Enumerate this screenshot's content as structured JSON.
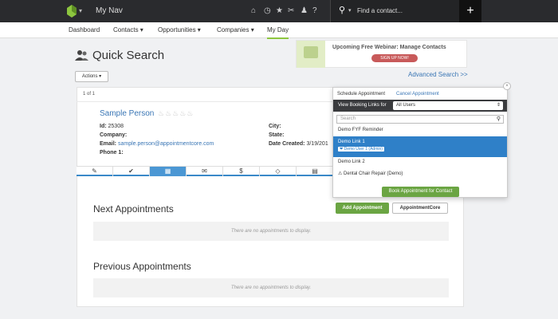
{
  "topbar": {
    "title": "My Nav",
    "search_placeholder": "Find a contact...",
    "icons": [
      "home-icon",
      "clock-icon",
      "star-icon",
      "tools-icon",
      "user-icon",
      "help-icon"
    ],
    "plus_label": "+"
  },
  "subnav": {
    "items": [
      {
        "label": "Dashboard"
      },
      {
        "label": "Contacts ▾"
      },
      {
        "label": "Opportunities ▾"
      },
      {
        "label": "Companies ▾"
      },
      {
        "label": "My Day"
      }
    ]
  },
  "page": {
    "title": "Quick Search",
    "actions_label": "Actions ▾",
    "advanced_search": "Advanced Search >>"
  },
  "webinar": {
    "title": "Upcoming Free Webinar: Manage Contacts",
    "signup": "SIGN UP NOW!"
  },
  "result": {
    "count": "1 of 1",
    "name": "Sample Person",
    "flames": "🔥🔥🔥🔥🔥",
    "id_label": "Id:",
    "id_value": "25308",
    "company_label": "Company:",
    "email_label": "Email:",
    "email_value": "sample.person@appointmentcore.com",
    "phone_label": "Phone 1:",
    "city_label": "City:",
    "state_label": "State:",
    "created_label": "Date Created:",
    "created_value": "3/19/201"
  },
  "tabs": [
    {
      "icon": "✎",
      "name": "edit-icon"
    },
    {
      "icon": "✔",
      "name": "check-icon"
    },
    {
      "icon": "▦",
      "name": "calendar-icon"
    },
    {
      "icon": "✉",
      "name": "mail-icon"
    },
    {
      "icon": "$",
      "name": "dollar-icon"
    },
    {
      "icon": "◇",
      "name": "tag-icon"
    },
    {
      "icon": "▤",
      "name": "document-icon"
    }
  ],
  "appointments": {
    "next_title": "Next Appointments",
    "previous_title": "Previous Appointments",
    "empty": "There are no appointments to display.",
    "add_label": "Add Appointment",
    "core_label": "AppointmentCore"
  },
  "popover": {
    "tab_schedule": "Schedule Appointment",
    "tab_cancel": "Cancel Appointment",
    "header_label": "View Booking Links for",
    "select_value": "All Users",
    "search_placeholder": "Search",
    "items": [
      {
        "label": "Demo FYF Reminder"
      },
      {
        "label": "Demo Link 1",
        "sub": "❤ Demo User 1 (Admin)"
      },
      {
        "label": "Demo Link 2"
      },
      {
        "label": "⚠  Dental Chair Repair (Demo)"
      }
    ],
    "book_label": "Book Appointment for Contact",
    "close": "×"
  }
}
